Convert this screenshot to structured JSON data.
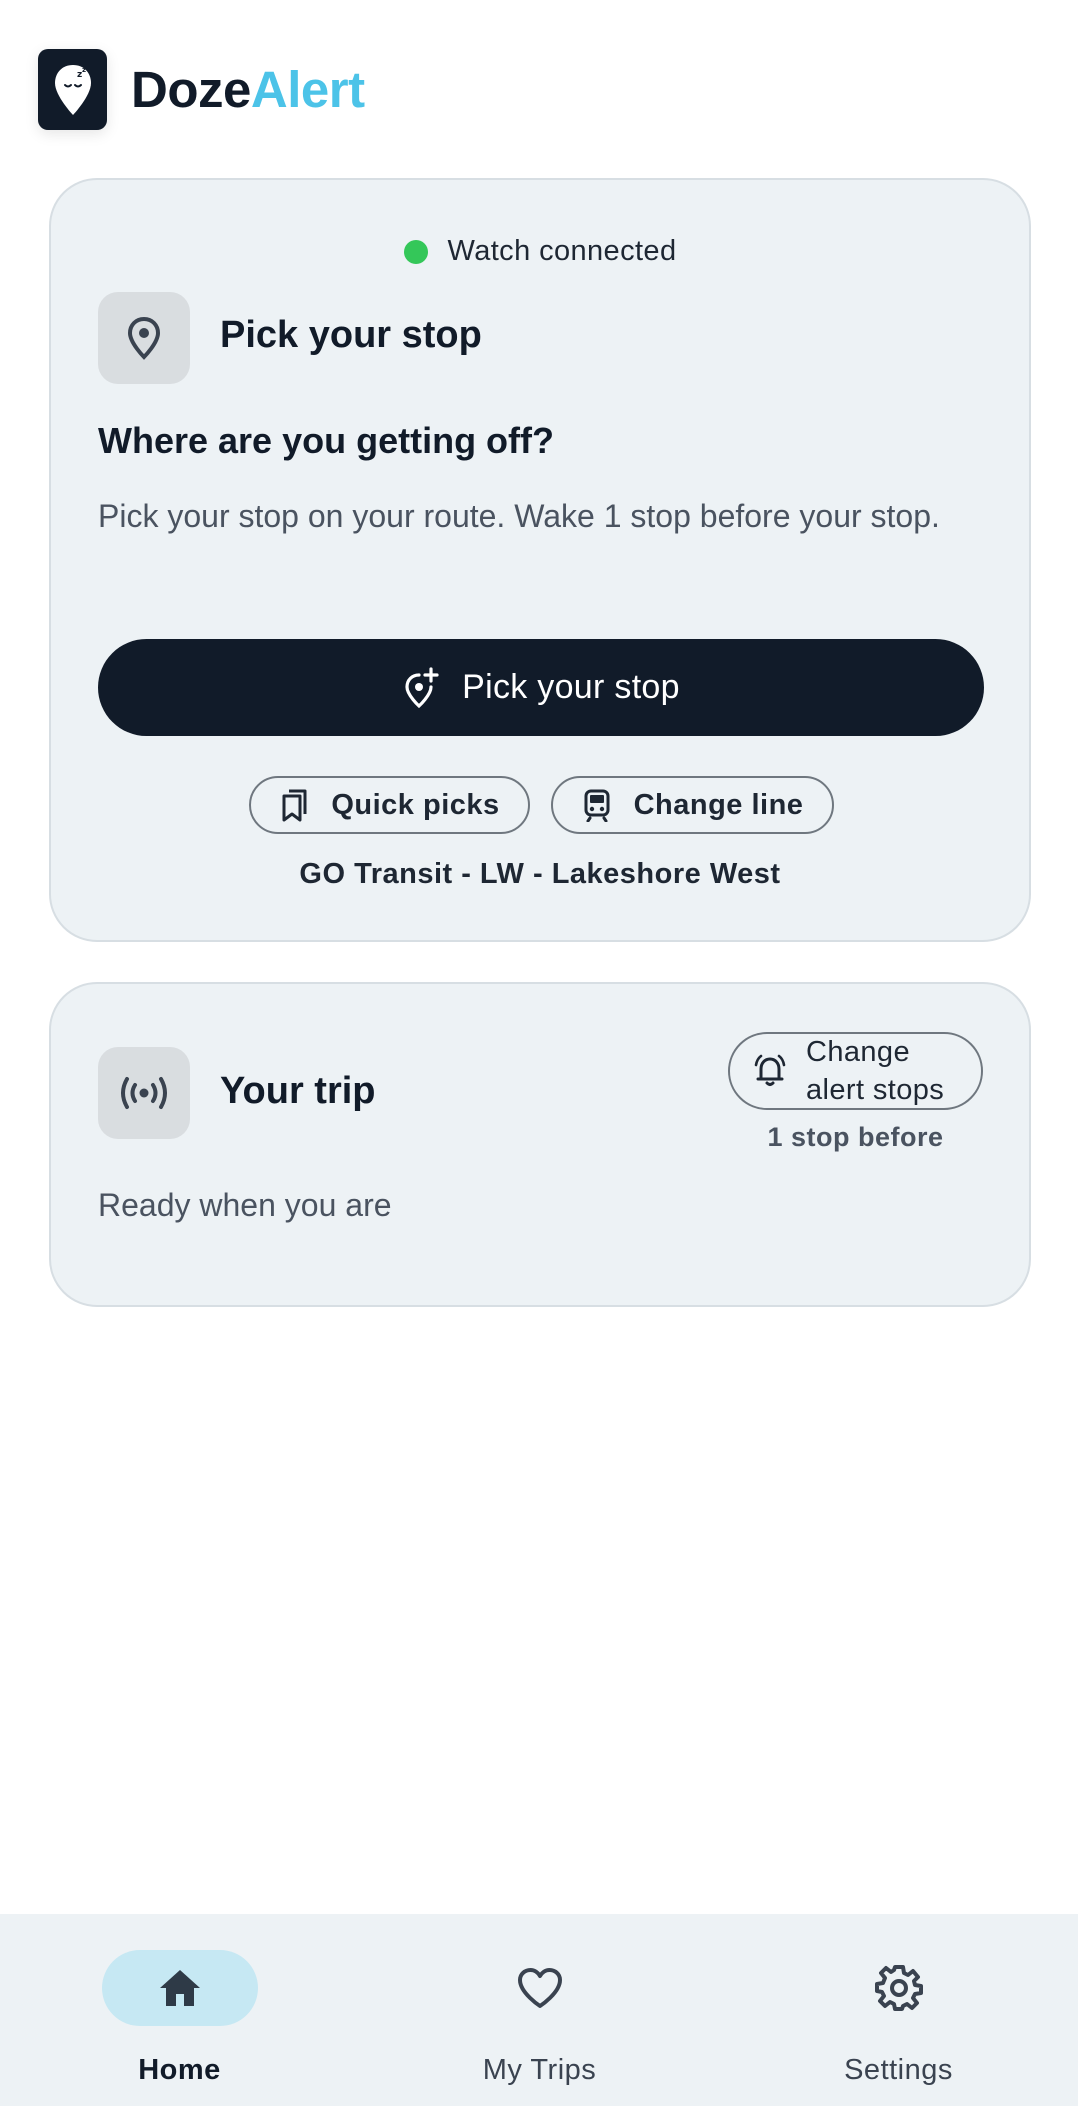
{
  "header": {
    "brand_part1": "Doze",
    "brand_part2": "Alert",
    "logo_icon": "sleeping-pin-icon"
  },
  "pick_card": {
    "watch_status": "Watch connected",
    "status_color": "#34c759",
    "title": "Pick your stop",
    "question": "Where are you getting off?",
    "description": "Pick your stop on your route. Wake 1 stop before your stop.",
    "primary_button": "Pick your stop",
    "quick_picks": "Quick picks",
    "change_line": "Change line",
    "line_label": "GO Transit - LW - Lakeshore West"
  },
  "trip_card": {
    "title": "Your trip",
    "alert_button": "Change alert stops",
    "alert_offset": "1 stop before",
    "status": "Ready when you are"
  },
  "nav": {
    "items": [
      {
        "label": "Home",
        "icon": "home-icon",
        "active": true
      },
      {
        "label": "My Trips",
        "icon": "heart-icon",
        "active": false
      },
      {
        "label": "Settings",
        "icon": "gear-icon",
        "active": false
      }
    ]
  },
  "colors": {
    "primary": "#111b29",
    "accent": "#4cc3e8",
    "card_bg": "#edf2f5",
    "nav_active": "#c6e8f3"
  }
}
